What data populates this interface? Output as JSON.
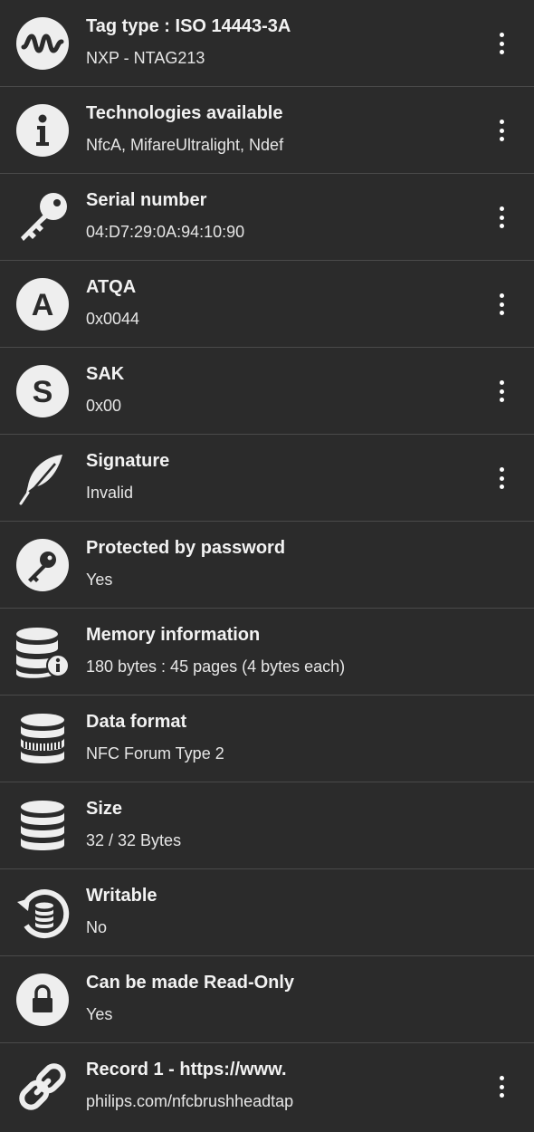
{
  "rows": [
    {
      "title": "Tag type : ISO 14443-3A",
      "value": "NXP - NTAG213",
      "icon": "waveform-icon",
      "has_menu": true
    },
    {
      "title": "Technologies available",
      "value": "NfcA, MifareUltralight, Ndef",
      "icon": "info-icon",
      "has_menu": true
    },
    {
      "title": "Serial number",
      "value": "04:D7:29:0A:94:10:90",
      "icon": "key-icon",
      "has_menu": true
    },
    {
      "title": "ATQA",
      "value": "0x0044",
      "icon": "letter-a-icon",
      "has_menu": true
    },
    {
      "title": "SAK",
      "value": "0x00",
      "icon": "letter-s-icon",
      "has_menu": true
    },
    {
      "title": "Signature",
      "value": "Invalid",
      "icon": "feather-icon",
      "has_menu": true
    },
    {
      "title": "Protected by password",
      "value": "Yes",
      "icon": "password-key-icon",
      "has_menu": false
    },
    {
      "title": "Memory information",
      "value": "180 bytes : 45 pages (4 bytes each)",
      "icon": "database-info-icon",
      "has_menu": false
    },
    {
      "title": "Data format",
      "value": "NFC Forum Type 2",
      "icon": "database-format-icon",
      "has_menu": false
    },
    {
      "title": "Size",
      "value": "32 / 32 Bytes",
      "icon": "database-icon",
      "has_menu": false
    },
    {
      "title": "Writable",
      "value": "No",
      "icon": "database-restore-icon",
      "has_menu": false
    },
    {
      "title": "Can be made Read-Only",
      "value": "Yes",
      "icon": "lock-icon",
      "has_menu": false
    },
    {
      "title": "Record 1 - https://www.",
      "value": "philips.com/nfcbrushheadtap",
      "icon": "link-icon",
      "has_menu": true
    }
  ],
  "colors": {
    "background": "#2b2b2b",
    "divider": "#4a4a4a",
    "text": "#ffffff"
  }
}
